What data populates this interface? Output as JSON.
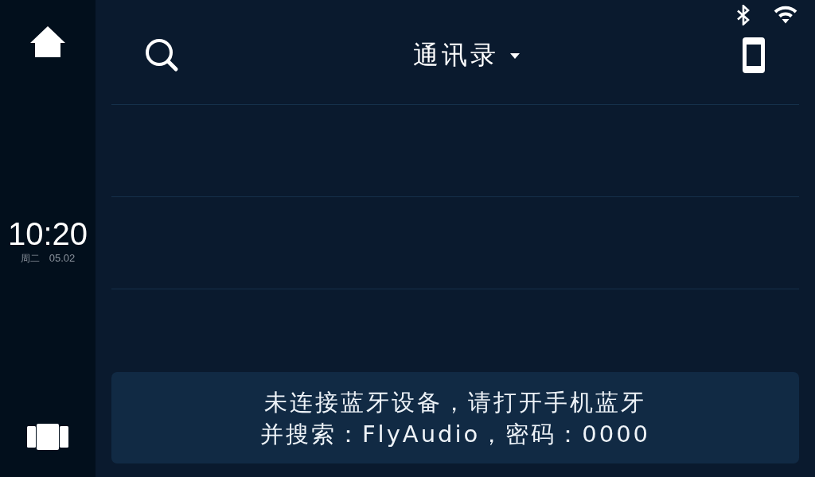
{
  "sidebar": {
    "time": "10:20",
    "weekday": "周二",
    "date": "05.02"
  },
  "header": {
    "title": "通讯录"
  },
  "notice": {
    "lines": [
      "未连接蓝牙设备，请打开手机蓝牙",
      "并搜索：FlyAudio，密码：0000"
    ]
  }
}
